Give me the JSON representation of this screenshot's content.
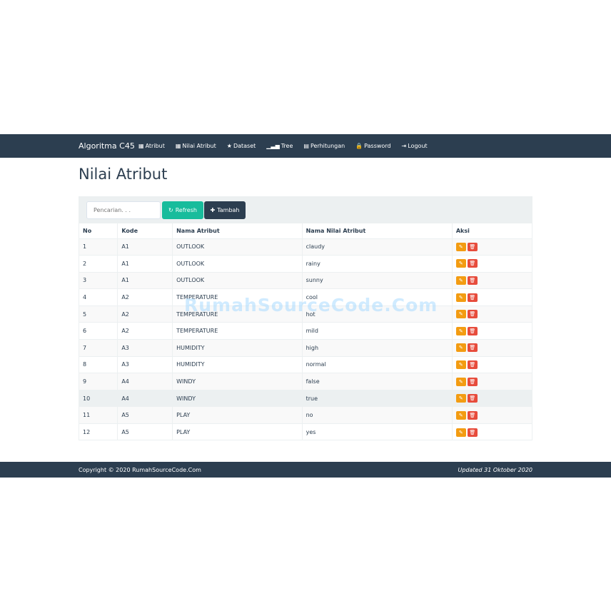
{
  "nav": {
    "brand": "Algoritma C45",
    "items": [
      {
        "label": "Atribut",
        "icon": "th-large-icon",
        "glyph": "▦"
      },
      {
        "label": "Nilai Atribut",
        "icon": "th-icon",
        "glyph": "▦"
      },
      {
        "label": "Dataset",
        "icon": "star-icon",
        "glyph": "★"
      },
      {
        "label": "Tree",
        "icon": "signal-icon",
        "glyph": "▁▃▅"
      },
      {
        "label": "Perhitungan",
        "icon": "calendar-icon",
        "glyph": "▤"
      },
      {
        "label": "Password",
        "icon": "lock-icon",
        "glyph": "🔒"
      },
      {
        "label": "Logout",
        "icon": "logout-icon",
        "glyph": "⇥"
      }
    ]
  },
  "page_title": "Nilai Atribut",
  "toolbar": {
    "search_placeholder": "Pencarian. . .",
    "refresh": "Refresh",
    "tambah": "Tambah"
  },
  "table": {
    "headers": [
      "No",
      "Kode",
      "Nama Atribut",
      "Nama Nilai Atribut",
      "Aksi"
    ],
    "rows": [
      [
        "1",
        "A1",
        "OUTLOOK",
        "claudy"
      ],
      [
        "2",
        "A1",
        "OUTLOOK",
        "rainy"
      ],
      [
        "3",
        "A1",
        "OUTLOOK",
        "sunny"
      ],
      [
        "4",
        "A2",
        "TEMPERATURE",
        "cool"
      ],
      [
        "5",
        "A2",
        "TEMPERATURE",
        "hot"
      ],
      [
        "6",
        "A2",
        "TEMPERATURE",
        "mild"
      ],
      [
        "7",
        "A3",
        "HUMIDITY",
        "high"
      ],
      [
        "8",
        "A3",
        "HUMIDITY",
        "normal"
      ],
      [
        "9",
        "A4",
        "WINDY",
        "false"
      ],
      [
        "10",
        "A4",
        "WINDY",
        "true"
      ],
      [
        "11",
        "A5",
        "PLAY",
        "no"
      ],
      [
        "12",
        "A5",
        "PLAY",
        "yes"
      ]
    ]
  },
  "footer": {
    "copyright": "Copyright © 2020 RumahSourceCode.Com",
    "updated": "Updated 31 Oktober 2020"
  },
  "watermark": "RumahSourceCode.Com",
  "colors": {
    "navbar": "#2c3e50",
    "refresh": "#18bc9c",
    "edit": "#f39c12",
    "delete": "#e74c3c"
  }
}
